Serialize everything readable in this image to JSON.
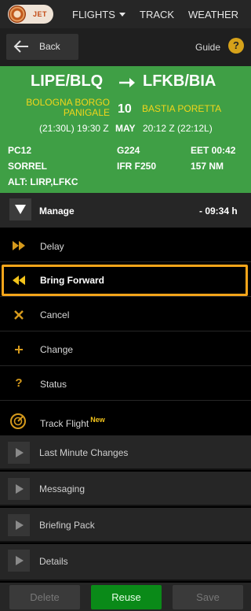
{
  "nav": {
    "logo_text": "JET",
    "flights": "FLIGHTS",
    "track": "TRACK",
    "weather": "WEATHER"
  },
  "backbar": {
    "back_label": "Back",
    "guide_label": "Guide",
    "guide_icon": "?"
  },
  "flight": {
    "from": "LIPE/BLQ",
    "to": "LFKB/BIA",
    "from_place": "BOLOGNA BORGO PANIGALE",
    "to_place": "BASTIA PORETTA",
    "day": "10",
    "month": "MAY",
    "from_time": "(21:30L) 19:30 Z",
    "to_time": "20:12 Z (22:12L)",
    "aircraft_type": "PC12",
    "registration": "G224",
    "eet": "EET 00:42",
    "callsign": "SORREL",
    "flight_rules": "IFR F250",
    "distance": "157 NM",
    "alternates": "ALT: LIRP,LFKC",
    "panel_color": "#3f9f45",
    "place_color": "#f2d51b"
  },
  "manage": {
    "label": "Manage",
    "time": "- 09:34 h"
  },
  "actions": [
    {
      "icon": "fast-forward-icon",
      "label": "Delay"
    },
    {
      "icon": "rewind-icon",
      "label": "Bring Forward"
    },
    {
      "icon": "close-icon",
      "label": "Cancel"
    },
    {
      "icon": "plus-icon",
      "label": "Change"
    },
    {
      "icon": "question-icon",
      "label": "Status"
    },
    {
      "icon": "radar-icon",
      "label": "Track Flight",
      "badge": "New"
    }
  ],
  "sections": [
    {
      "label": "Last Minute Changes"
    },
    {
      "label": "Messaging"
    },
    {
      "label": "Briefing Pack"
    },
    {
      "label": "Details"
    }
  ],
  "footer": {
    "delete": "Delete",
    "reuse": "Reuse",
    "save": "Save"
  },
  "colors": {
    "accent": "#d69a1c",
    "highlight": "#f5a51a",
    "reuse": "#0a8a18"
  }
}
